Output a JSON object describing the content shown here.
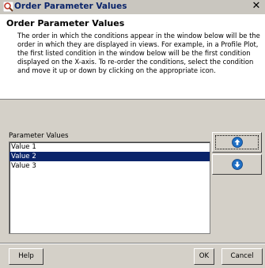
{
  "window": {
    "title": "Order Parameter Values",
    "close_symbol": "✕",
    "icon": "magnifier-app-icon"
  },
  "header": {
    "title": "Order Parameter Values",
    "description": "The order in which the conditions appear in the window below will be the order in which they are displayed in views. For example, in a Profile Plot, the first listed condition in the window below will be the first condition displayed on the X-axis. To re-order the conditions, select the condition and move it up or down by clicking on the appropriate icon."
  },
  "parameters": {
    "label": "Parameter Values",
    "items": [
      "Value 1",
      "Value 2",
      "Value 3"
    ],
    "selected_index": 1
  },
  "controls": {
    "move_up_icon": "arrow-up-icon",
    "move_down_icon": "arrow-down-icon"
  },
  "footer": {
    "help_label": "Help",
    "ok_label": "OK",
    "cancel_label": "Cancel"
  },
  "colors": {
    "title_text": "#0a246a",
    "selection": "#0a246a",
    "dialog_bg": "#d4d0c8",
    "icon_blue": "#1f6fc4"
  }
}
